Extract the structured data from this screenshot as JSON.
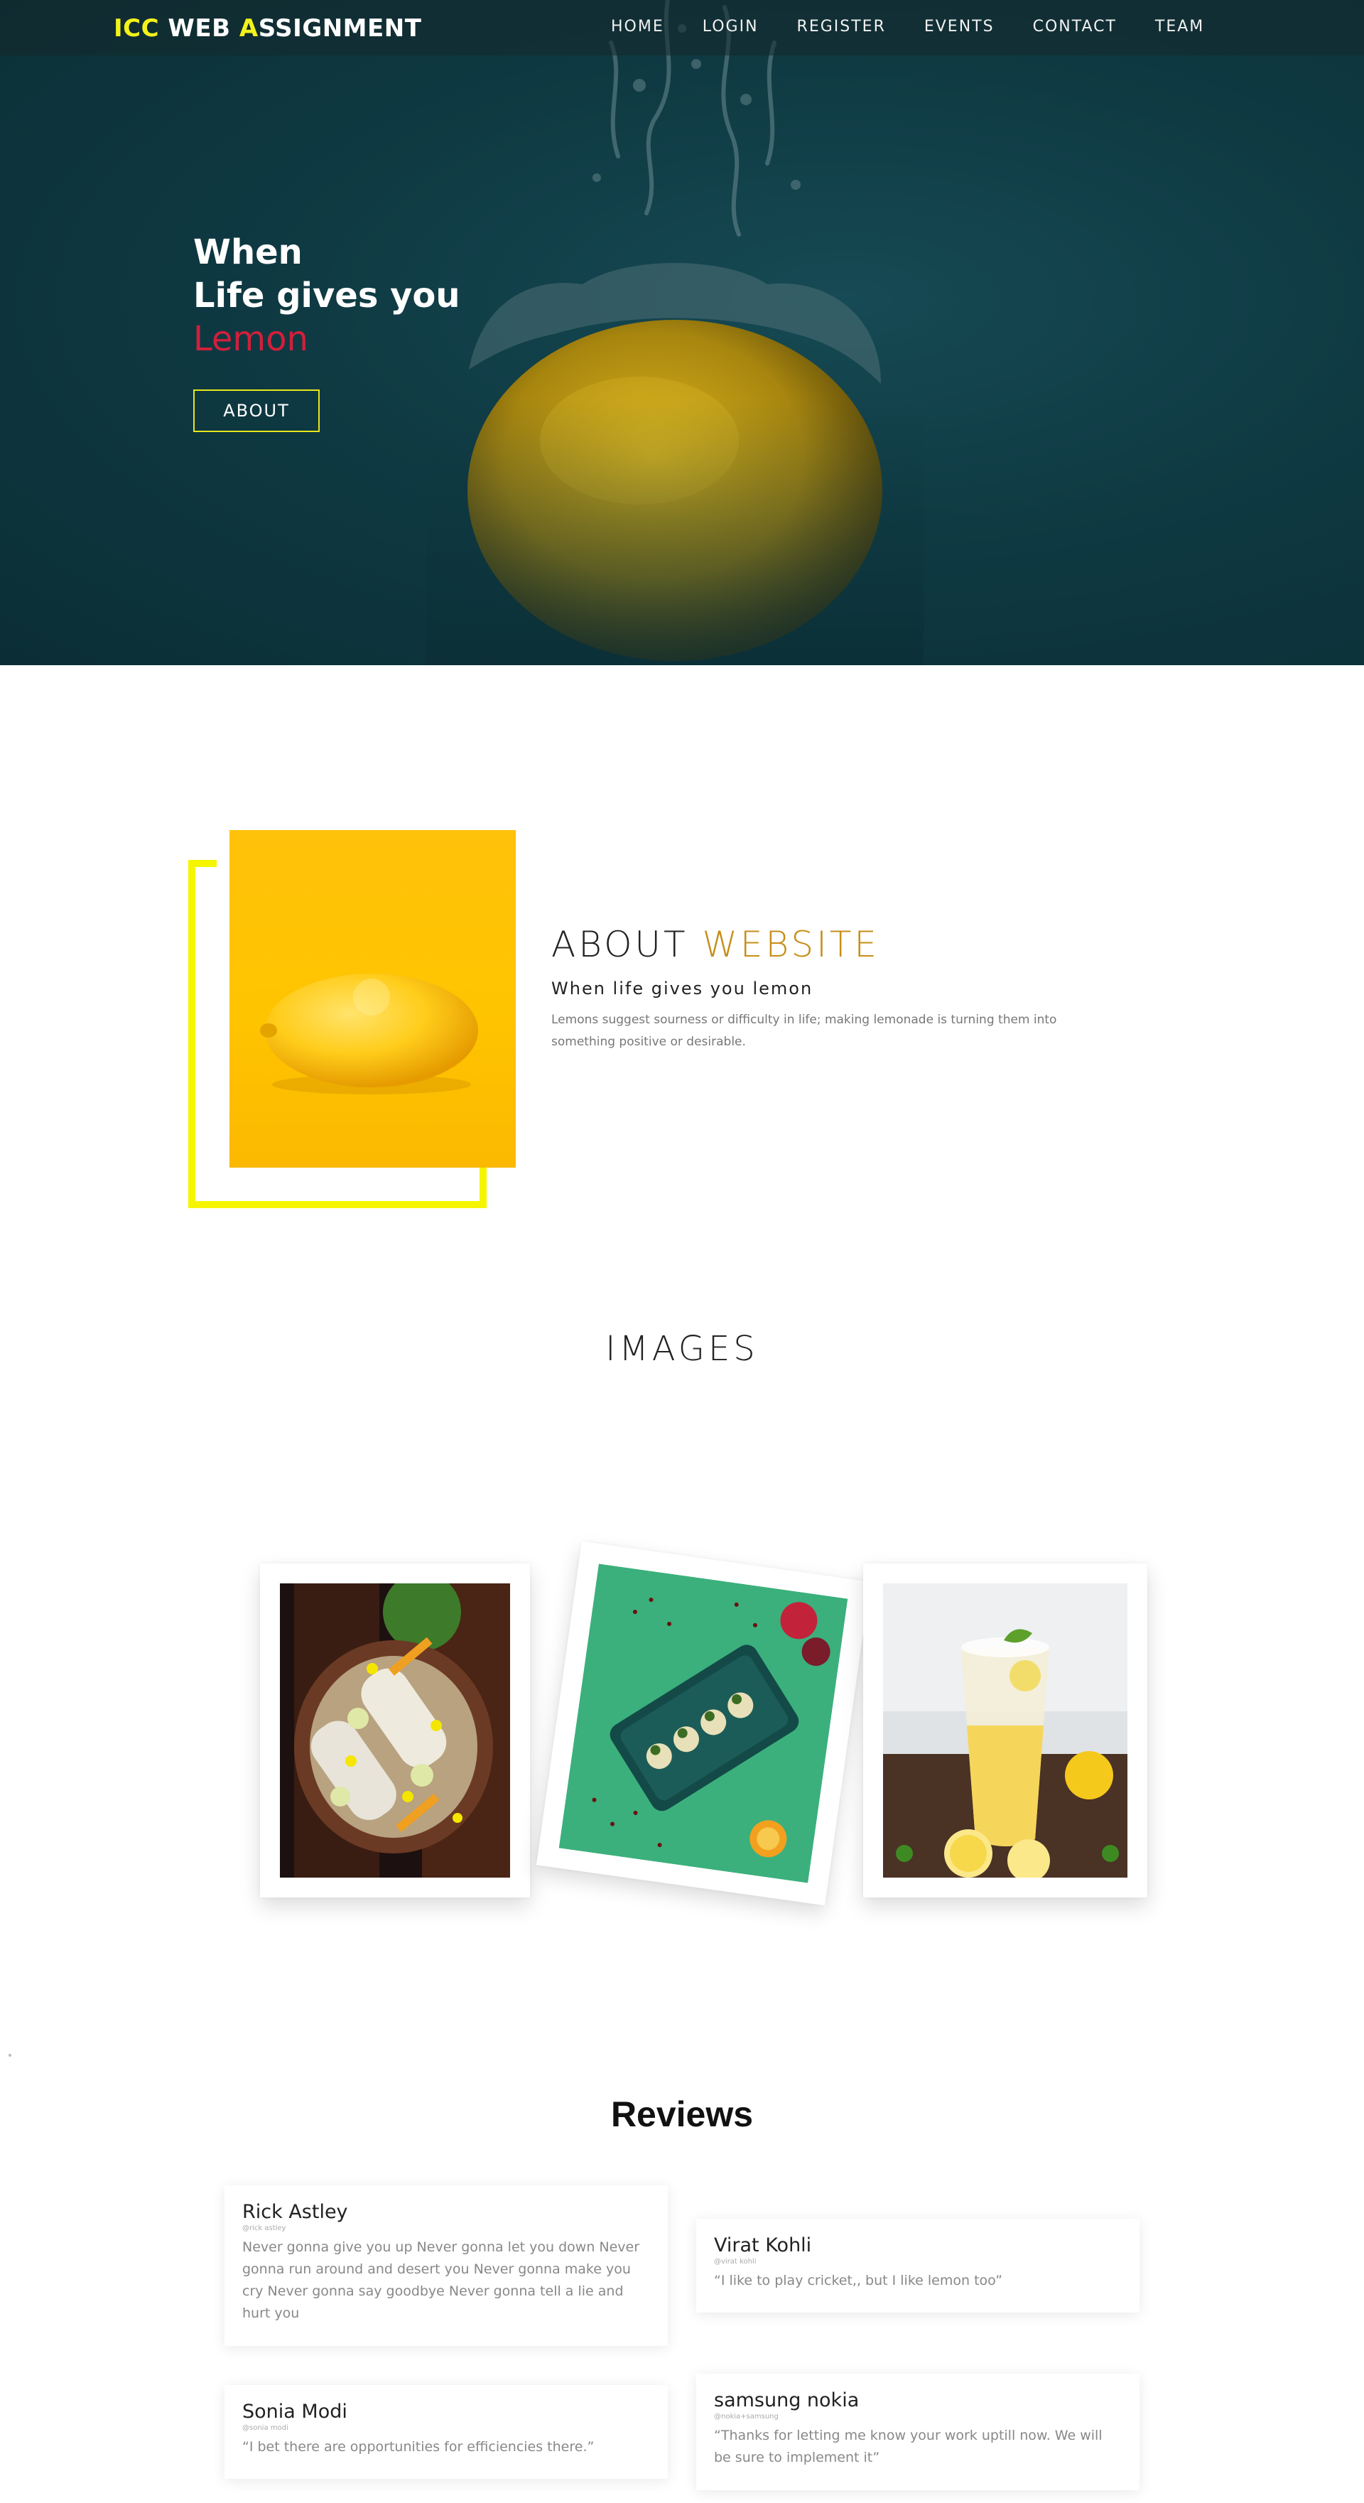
{
  "brand": {
    "part1": "ICC",
    "part2": " WEB ",
    "part3": "A",
    "part4": "SSIGNMENT"
  },
  "nav": {
    "items": [
      {
        "label": "HOME"
      },
      {
        "label": "LOGIN"
      },
      {
        "label": "REGISTER"
      },
      {
        "label": "EVENTS"
      },
      {
        "label": "CONTACT"
      },
      {
        "label": "TEAM"
      }
    ]
  },
  "hero": {
    "line1": "When",
    "line2": "Life gives you",
    "line3": "Lemon",
    "button_label": "ABOUT"
  },
  "about": {
    "title_part1": "ABOUT ",
    "title_part2": "WEBSITE",
    "subtitle": "When life gives you lemon",
    "description": "Lemons suggest sourness or difficulty in life; making lemonade is turning them into something positive or desirable."
  },
  "images": {
    "title": "IMAGES"
  },
  "reviews": {
    "title": "Reviews",
    "items": [
      {
        "name": "Rick Astley",
        "handle": "@rick astley",
        "text": "Never gonna give you up Never gonna let you down Never gonna run around and desert you Never gonna make you cry Never gonna say goodbye Never gonna tell a lie and hurt you"
      },
      {
        "name": "Virat Kohli",
        "handle": "@virat kohli",
        "text": "“I like to play cricket,, but I like lemon too”"
      },
      {
        "name": "Sonia Modi",
        "handle": "@sonia modi",
        "text": "“I bet there are opportunities for efficiencies there.”"
      },
      {
        "name": "samsung nokia",
        "handle": "@nokia+samsung",
        "text": "“Thanks for letting me know your work uptill now. We will be sure to implement it”"
      }
    ]
  },
  "colors": {
    "hero_bg": "#0f3a43",
    "brand_accent": "#f3f21a",
    "lemon_red": "#d21f3c",
    "about_gold": "#c68e17",
    "frame_yellow": "#f5f500"
  }
}
